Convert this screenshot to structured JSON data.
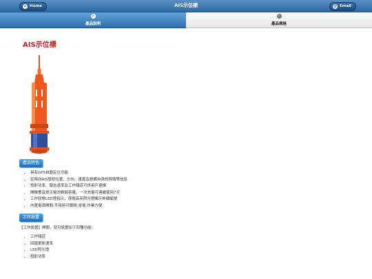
{
  "header": {
    "title": "AIS示位標",
    "home_label": "Home",
    "email_label": "Email"
  },
  "tabs": [
    {
      "label": "產品說明",
      "icon": "home-icon",
      "active": true
    },
    {
      "label": "產品規格",
      "icon": "info-icon",
      "active": false
    }
  ],
  "main": {
    "page_title": "AIS示位標",
    "features_label": "產品特色",
    "features": [
      "具有GPS自動定位功能",
      "定時向AIS發射位置、方向、速度及設備自身的辨識等信息",
      "發射功率、報告速率及工作頻道可供用戶選擇",
      "開機響音提示電池剩餘容量，一次充電可連續使用7天",
      "工作狀態LED燈指示，夜晚高亮閃光燈顯示佈網編號",
      "內置電源開關,不用時可關閉,省電,作業方便"
    ],
    "settings_label": "工作設置",
    "settings_intro": "【工作設置】開關，就可設置如下四種功能：",
    "settings": [
      "工作頻道",
      "回報更新速率",
      "LED閃光燈",
      "發射功率"
    ]
  },
  "colors": {
    "header_blue": "#2f6aa6",
    "title_red": "#c02020",
    "device_orange": "#f0571c",
    "device_blue": "#2e4f9e"
  }
}
